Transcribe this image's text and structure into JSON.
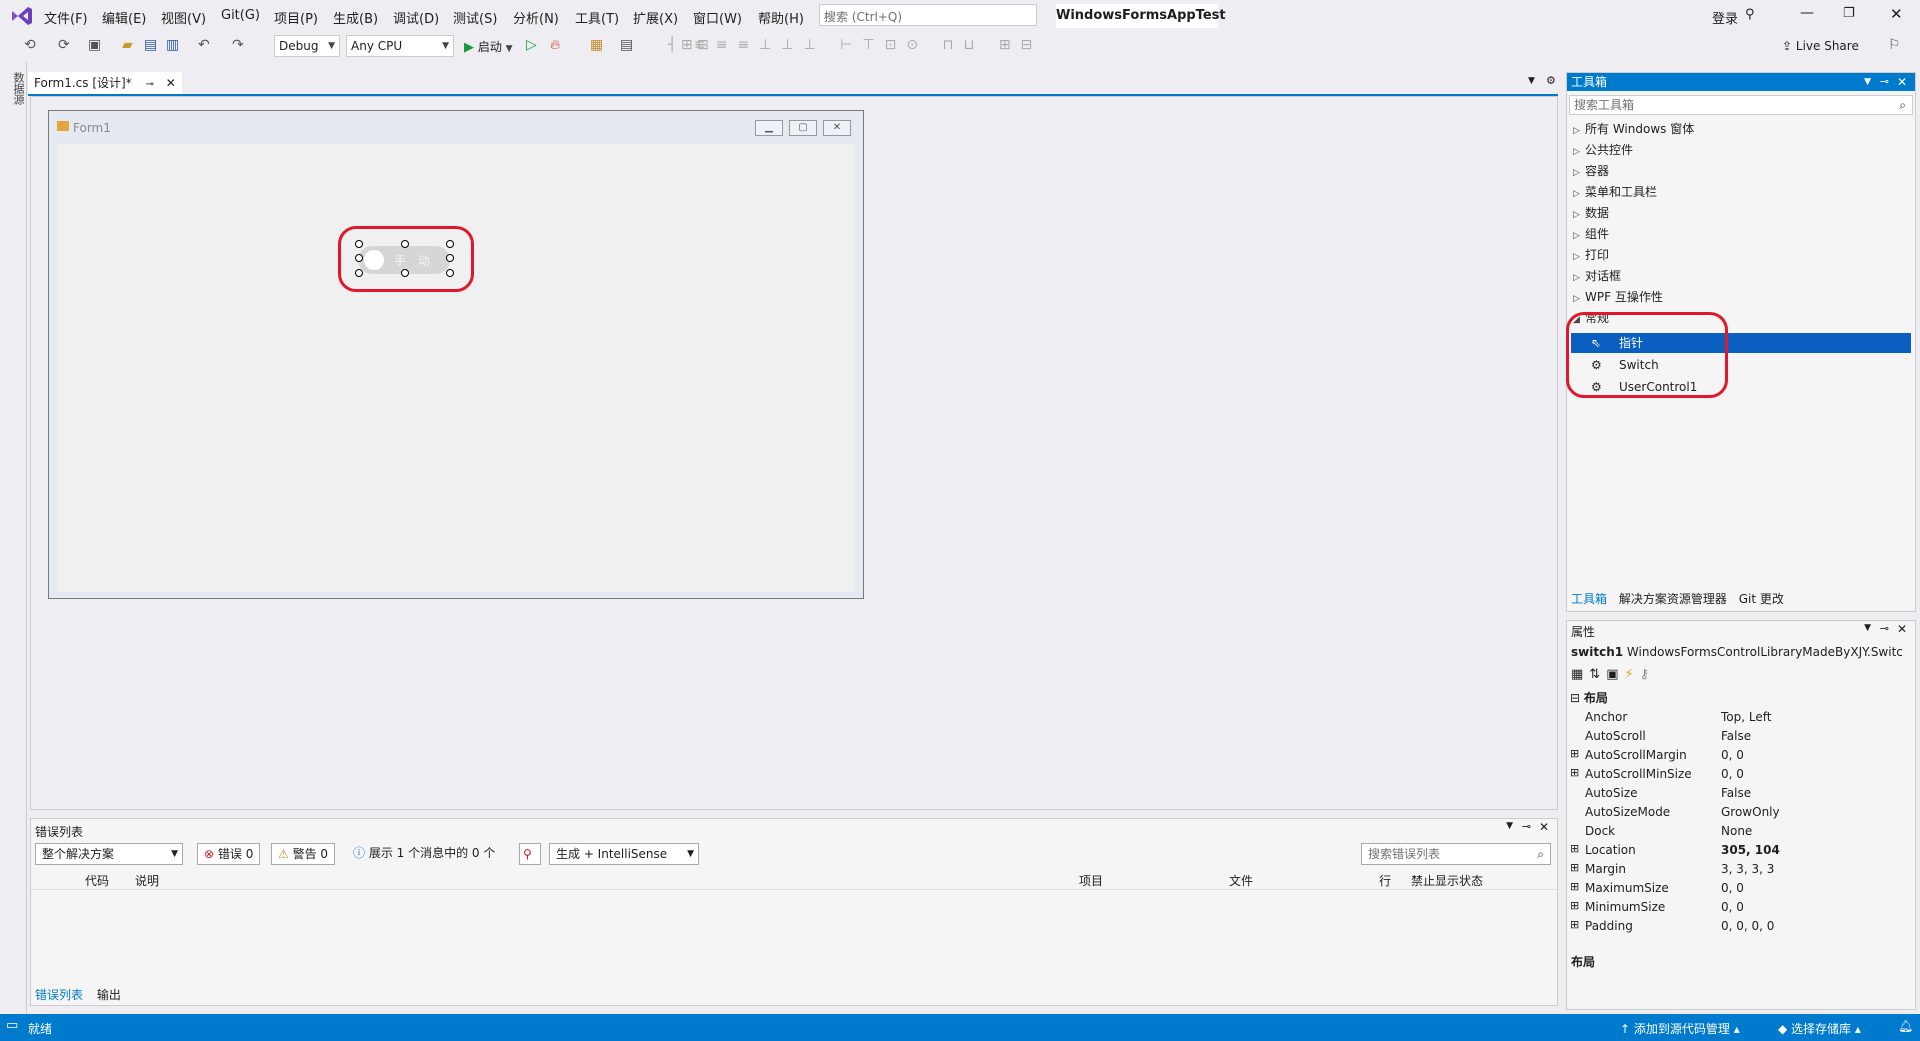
{
  "menu": {
    "items": [
      "文件(F)",
      "编辑(E)",
      "视图(V)",
      "Git(G)",
      "项目(P)",
      "生成(B)",
      "调试(D)",
      "测试(S)",
      "分析(N)",
      "工具(T)",
      "扩展(X)",
      "窗口(W)",
      "帮助(H)"
    ],
    "search_placeholder": "搜索 (Ctrl+Q)",
    "app_title": "WindowsFormsAppTest",
    "login": "登录"
  },
  "toolbar": {
    "config": "Debug",
    "platform": "Any CPU",
    "start": "启动",
    "live_share": "Live Share"
  },
  "left_strip": {
    "label": "数据源"
  },
  "document": {
    "tab_label": "Form1.cs [设计]*",
    "form_title": "Form1",
    "switch_text": "手动"
  },
  "error_list": {
    "title": "错误列表",
    "scope": "整个解决方案",
    "errors": "错误 0",
    "warnings": "警告 0",
    "messages": "展示 1 个消息中的 0 个",
    "build_filter": "生成 + IntelliSense",
    "search_placeholder": "搜索错误列表",
    "columns": [
      "代码",
      "说明",
      "项目",
      "文件",
      "行",
      "禁止显示状态"
    ],
    "tabs": [
      "错误列表",
      "输出"
    ]
  },
  "toolbox": {
    "title": "工具箱",
    "search_placeholder": "搜索工具箱",
    "categories": [
      "所有 Windows 窗体",
      "公共控件",
      "容器",
      "菜单和工具栏",
      "数据",
      "组件",
      "打印",
      "对话框",
      "WPF 互操作性",
      "常规"
    ],
    "tools": [
      "指针",
      "Switch",
      "UserControl1"
    ],
    "selected_tool": "指针",
    "tabs": [
      "工具箱",
      "解决方案资源管理器",
      "Git 更改"
    ]
  },
  "properties": {
    "title": "属性",
    "object_name": "switch1",
    "object_type": "WindowsFormsControlLibraryMadeByXJY.Switc",
    "category": "布局",
    "rows": [
      {
        "name": "Anchor",
        "value": "Top, Left",
        "expandable": false,
        "bold": false
      },
      {
        "name": "AutoScroll",
        "value": "False",
        "expandable": false,
        "bold": false
      },
      {
        "name": "AutoScrollMargin",
        "value": "0, 0",
        "expandable": true,
        "bold": false
      },
      {
        "name": "AutoScrollMinSize",
        "value": "0, 0",
        "expandable": true,
        "bold": false
      },
      {
        "name": "AutoSize",
        "value": "False",
        "expandable": false,
        "bold": false
      },
      {
        "name": "AutoSizeMode",
        "value": "GrowOnly",
        "expandable": false,
        "bold": false
      },
      {
        "name": "Dock",
        "value": "None",
        "expandable": false,
        "bold": false
      },
      {
        "name": "Location",
        "value": "305, 104",
        "expandable": true,
        "bold": true
      },
      {
        "name": "Margin",
        "value": "3, 3, 3, 3",
        "expandable": true,
        "bold": false
      },
      {
        "name": "MaximumSize",
        "value": "0, 0",
        "expandable": true,
        "bold": false
      },
      {
        "name": "MinimumSize",
        "value": "0, 0",
        "expandable": true,
        "bold": false
      },
      {
        "name": "Padding",
        "value": "0, 0, 0, 0",
        "expandable": true,
        "bold": false
      }
    ],
    "description_title": "布局"
  },
  "status": {
    "text": "就绪",
    "source_control": "添加到源代码管理",
    "repository": "选择存储库"
  },
  "colors": {
    "accent": "#007acc",
    "selection": "#0a5fc0",
    "highlight_ring": "#e0182b"
  }
}
